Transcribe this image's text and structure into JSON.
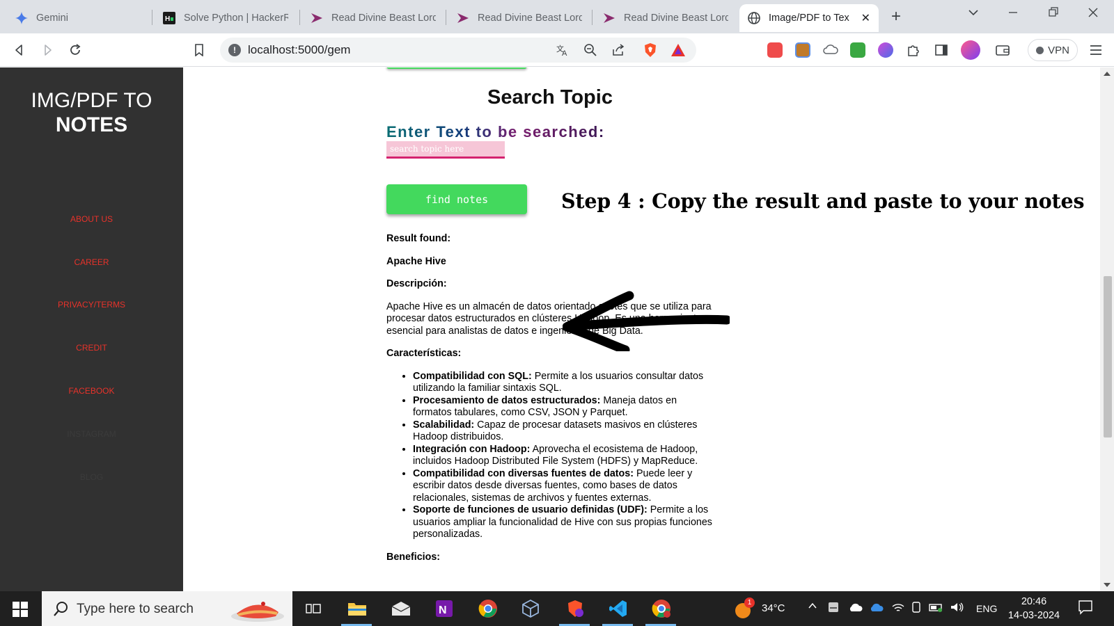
{
  "browser": {
    "tabs": [
      {
        "title": "Gemini",
        "icon": "gemini-icon"
      },
      {
        "title": "Solve Python | HackerR",
        "icon": "hackerrank-icon"
      },
      {
        "title": "Read Divine Beast Lord",
        "icon": "manga-site-icon"
      },
      {
        "title": "Read Divine Beast Lord",
        "icon": "manga-site-icon"
      },
      {
        "title": "Read Divine Beast Lord",
        "icon": "manga-site-icon"
      },
      {
        "title": "Image/PDF to Tex",
        "icon": "globe-icon",
        "active": true
      }
    ],
    "url": "localhost:5000/gem",
    "vpn_label": "VPN"
  },
  "sidebar": {
    "logo_line1": "IMG/PDF TO",
    "logo_line2": "NOTES",
    "links": [
      "ABOUT US",
      "CAREER",
      "PRIVACY/TERMS",
      "CREDIT",
      "FACEBOOK"
    ],
    "hidden_links": [
      "INSTAGRAM",
      "BLOG"
    ]
  },
  "main": {
    "title": "Search Topic",
    "input_label": "Enter Text to be searched:",
    "input_placeholder": "search topic here",
    "button_label": "find notes",
    "annotation": "Step 4 : Copy the result and paste to your notes",
    "result_found": "Result found:",
    "topic": "Apache Hive",
    "desc_heading": "Descripción:",
    "description": "Apache Hive es un almacén de datos orientado a lotes que se utiliza para procesar datos estructurados en clústeres Hadoop. Es una herramienta esencial para analistas de datos e ingenieros de Big Data.",
    "features_heading": "Características:",
    "features": [
      {
        "title": "Compatibilidad con SQL:",
        "text": " Permite a los usuarios consultar datos utilizando la familiar sintaxis SQL."
      },
      {
        "title": "Procesamiento de datos estructurados:",
        "text": " Maneja datos en formatos tabulares, como CSV, JSON y Parquet."
      },
      {
        "title": "Scalabilidad:",
        "text": " Capaz de procesar datasets masivos en clústeres Hadoop distribuidos."
      },
      {
        "title": "Integración con Hadoop:",
        "text": " Aprovecha el ecosistema de Hadoop, incluidos Hadoop Distributed File System (HDFS) y MapReduce."
      },
      {
        "title": "Compatibilidad con diversas fuentes de datos:",
        "text": " Puede leer y escribir datos desde diversas fuentes, como bases de datos relacionales, sistemas de archivos y fuentes externas."
      },
      {
        "title": "Soporte de funciones de usuario definidas (UDF):",
        "text": " Permite a los usuarios ampliar la funcionalidad de Hive con sus propias funciones personalizadas."
      }
    ],
    "benefits_heading": "Beneficios:"
  },
  "taskbar": {
    "search_text": "Type here to search",
    "weather": "34°C",
    "weather_badge": "1",
    "language": "ENG",
    "time": "20:46",
    "date": "14-03-2024"
  },
  "colors": {
    "sidebar_bg": "#313131",
    "nav_link": "#e8322a",
    "button_green": "#43d95d",
    "input_bg": "#f6c6d7",
    "input_border": "#d4226e"
  }
}
